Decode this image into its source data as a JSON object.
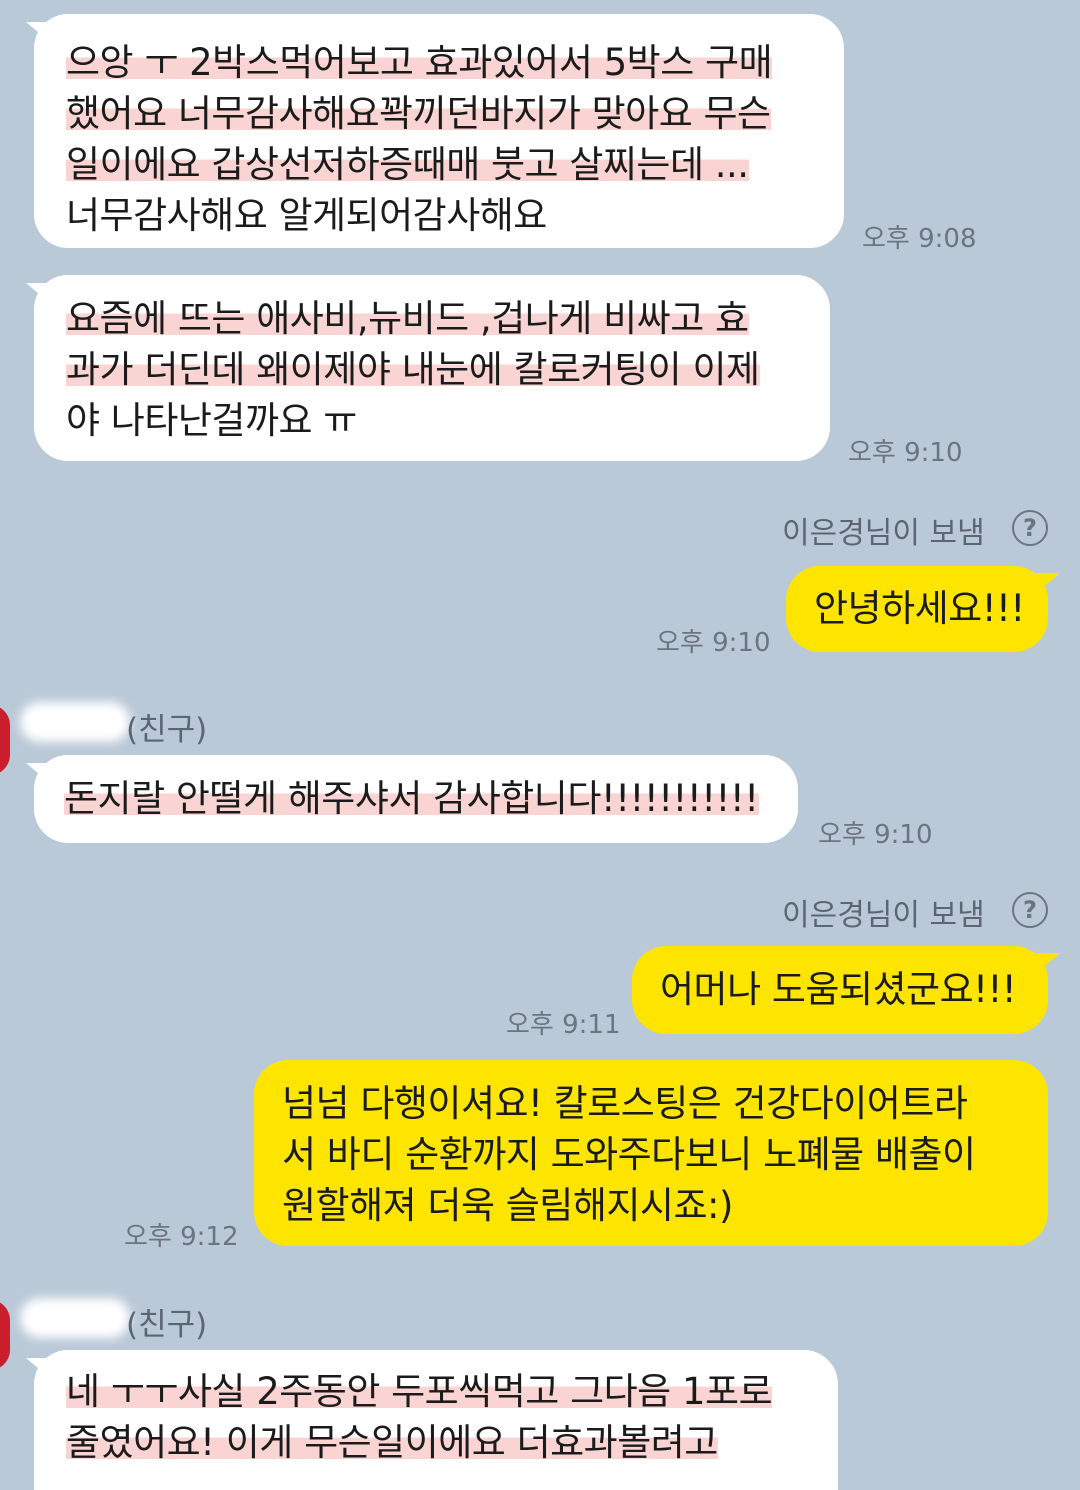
{
  "messages": [
    {
      "lines": [
        "으앙 ㅜ 2박스먹어보고 효과있어서 5박스 구매",
        "했어요 너무감사해요꽉끼던바지가 맞아요 무슨",
        "일이에요 갑상선저하증때매 붓고 살찌는데 ...",
        "너무감사해요 알게되어감사해요"
      ],
      "time": "오후 9:08"
    },
    {
      "lines": [
        "요즘에 뜨는 애사비,뉴비드 ,겁나게 비싸고 효",
        "과가 더딘데 왜이제야 내눈에 칼로커팅이 이제",
        "야 나타난걸까요 ㅠ"
      ],
      "time": "오후 9:10"
    },
    {
      "sent_label": "이은경님이 보냄",
      "lines": [
        "안녕하세요!!!"
      ],
      "time": "오후 9:10"
    },
    {
      "sender": "(친구)",
      "lines": [
        "돈지랄 안떨게 해주샤서 감사합니다!!!!!!!!!!!"
      ],
      "time": "오후 9:10"
    },
    {
      "sent_label": "이은경님이 보냄",
      "lines": [
        "어머나 도움되셨군요!!!"
      ],
      "time": "오후 9:11"
    },
    {
      "lines": [
        "넘넘 다행이셔요!  칼로스팅은 건강다이어트라",
        "서 바디 순환까지 도와주다보니 노폐물 배출이",
        "원할해져 더욱 슬림해지시죠:)"
      ],
      "time": "오후 9:12"
    },
    {
      "sender": "(친구)",
      "lines": [
        "네 ㅜㅜ사실 2주동안 두포씩먹고 그다음 1포로",
        "줄였어요! 이게 무슨일이에요 더효과볼려고"
      ]
    }
  ],
  "icons": {
    "help": "help-circle-icon"
  },
  "colors": {
    "background": "#bac9d8",
    "outgoing": "#fee500",
    "incoming": "#ffffff"
  }
}
